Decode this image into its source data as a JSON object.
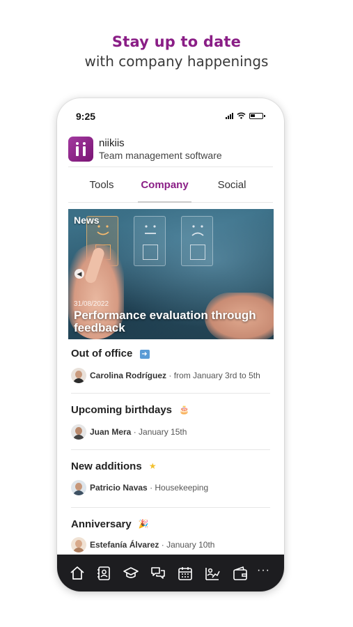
{
  "promo": {
    "headline": "Stay up to date",
    "subheadline": "with company happenings"
  },
  "status_bar": {
    "time": "9:25"
  },
  "app": {
    "name": "niikiis",
    "subtitle": "Team management software",
    "brand_color": "#8a1e86"
  },
  "tabs": [
    {
      "label": "Tools",
      "active": false
    },
    {
      "label": "Company",
      "active": true
    },
    {
      "label": "Social",
      "active": false
    }
  ],
  "news": {
    "label": "News",
    "date": "31/08/2022",
    "title": "Performance evaluation through feedback"
  },
  "sections": {
    "out_of_office": {
      "title": "Out of office",
      "icon": "arrow-right-emoji",
      "person": "Carolina Rodríguez",
      "detail": "· from January 3rd to 5th"
    },
    "birthdays": {
      "title": "Upcoming birthdays",
      "icon": "cake-emoji",
      "person": "Juan Mera",
      "detail": "· January 15th"
    },
    "new_additions": {
      "title": "New additions",
      "icon": "star-emoji",
      "person": "Patricio Navas",
      "detail": "· Housekeeping"
    },
    "anniversary": {
      "title": "Anniversary",
      "icon": "party-popper-emoji",
      "person": "Estefanía Álvarez",
      "detail": "· January 10th"
    }
  },
  "bottom_nav": [
    {
      "icon": "home-icon"
    },
    {
      "icon": "contacts-icon"
    },
    {
      "icon": "graduation-cap-icon"
    },
    {
      "icon": "chat-icon"
    },
    {
      "icon": "calendar-icon"
    },
    {
      "icon": "analytics-icon"
    },
    {
      "icon": "wallet-icon"
    },
    {
      "icon": "more-icon",
      "label": "···"
    }
  ]
}
